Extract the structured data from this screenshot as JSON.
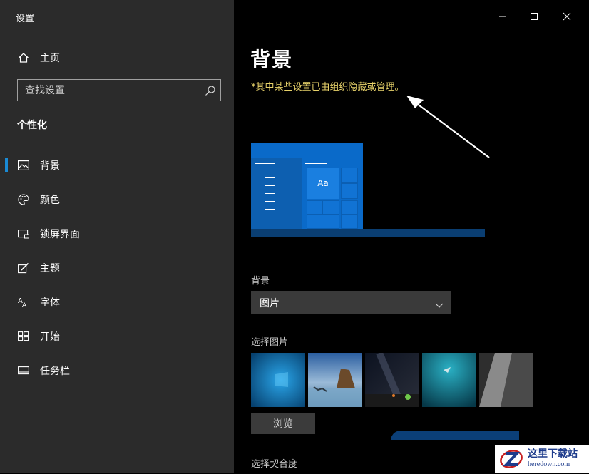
{
  "window": {
    "title": "设置",
    "controls": {
      "minimize_icon": "minimize-icon",
      "maximize_icon": "maximize-icon",
      "close_icon": "close-icon"
    }
  },
  "sidebar": {
    "home_label": "主页",
    "search_placeholder": "查找设置",
    "section_title": "个性化",
    "items": [
      {
        "label": "背景",
        "icon": "image-icon",
        "active": true
      },
      {
        "label": "颜色",
        "icon": "palette-icon",
        "active": false
      },
      {
        "label": "锁屏界面",
        "icon": "lock-screen-icon",
        "active": false
      },
      {
        "label": "主题",
        "icon": "theme-icon",
        "active": false
      },
      {
        "label": "字体",
        "icon": "font-icon",
        "active": false
      },
      {
        "label": "开始",
        "icon": "start-icon",
        "active": false
      },
      {
        "label": "任务栏",
        "icon": "taskbar-icon",
        "active": false
      }
    ]
  },
  "main": {
    "page_title": "背景",
    "warning": "*其中某些设置已由组织隐藏或管理。",
    "preview": {
      "tile_text": "Aa"
    },
    "background_label": "背景",
    "background_value": "图片",
    "choose_picture_label": "选择图片",
    "browse_label": "浏览",
    "choose_fit_label": "选择契合度"
  },
  "watermark": {
    "name": "这里下载站",
    "url": "heredown.com"
  },
  "colors": {
    "accent": "#1a8ad4",
    "warning": "#e8d26a",
    "sidebar_bg": "#2b2b2b",
    "main_bg": "#000000"
  }
}
